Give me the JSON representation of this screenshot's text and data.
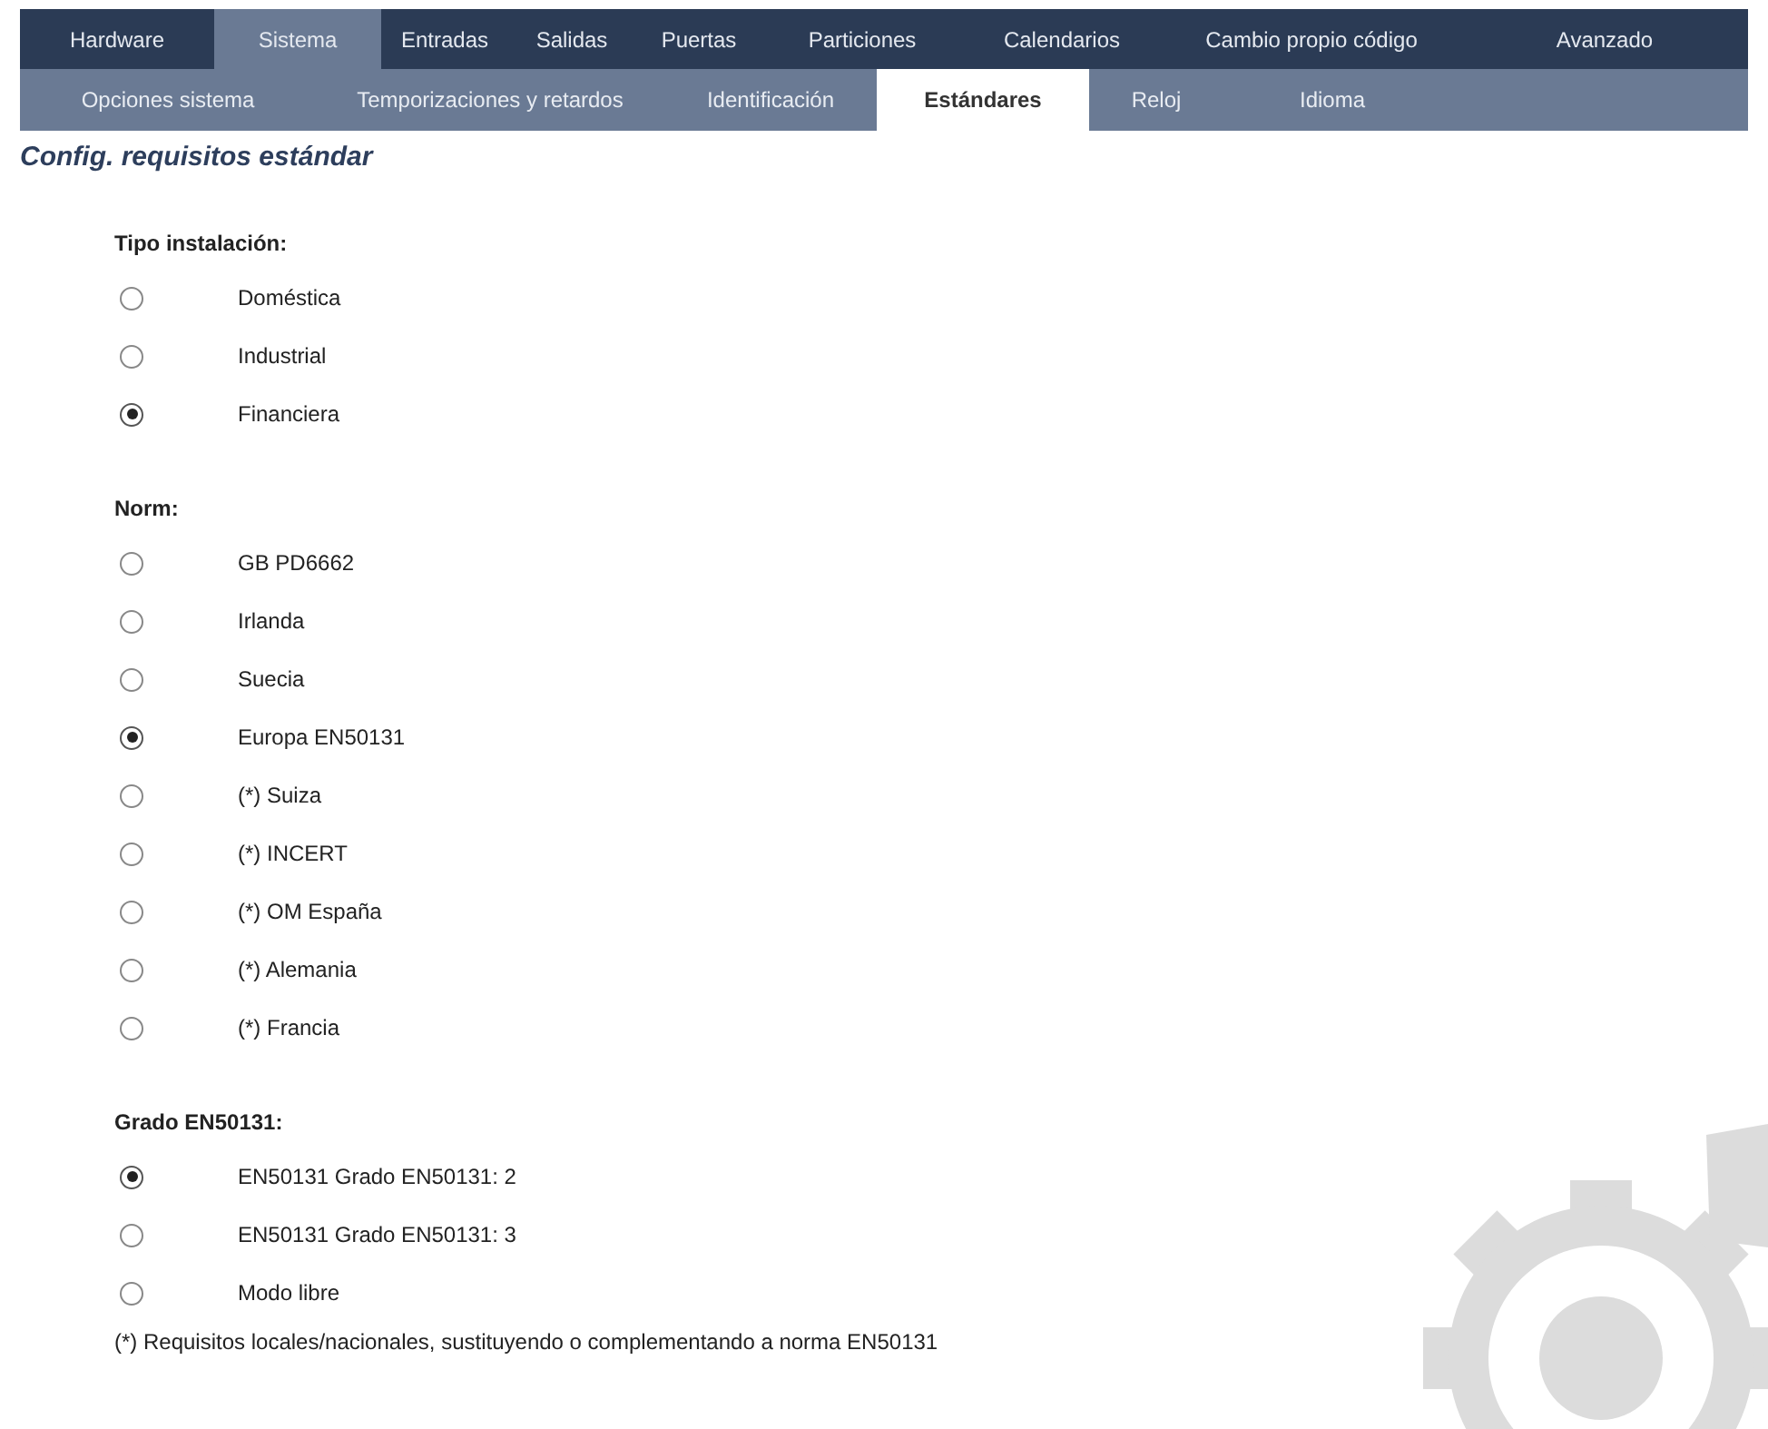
{
  "main_tabs": [
    {
      "label": "Hardware",
      "selected": false
    },
    {
      "label": "Sistema",
      "selected": true
    },
    {
      "label": "Entradas",
      "selected": false
    },
    {
      "label": "Salidas",
      "selected": false
    },
    {
      "label": "Puertas",
      "selected": false
    },
    {
      "label": "Particiones",
      "selected": false
    },
    {
      "label": "Calendarios",
      "selected": false
    },
    {
      "label": "Cambio propio código",
      "selected": false
    },
    {
      "label": "Avanzado",
      "selected": false
    }
  ],
  "sub_tabs": [
    {
      "label": "Opciones sistema",
      "selected": false
    },
    {
      "label": "Temporizaciones y retardos",
      "selected": false
    },
    {
      "label": "Identificación",
      "selected": false
    },
    {
      "label": "Estándares",
      "selected": true
    },
    {
      "label": "Reloj",
      "selected": false
    },
    {
      "label": "Idioma",
      "selected": false
    }
  ],
  "title": "Config. requisitos estándar",
  "groups": [
    {
      "heading": "Tipo instalación:",
      "options": [
        {
          "label": "Doméstica",
          "selected": false
        },
        {
          "label": "Industrial",
          "selected": false
        },
        {
          "label": "Financiera",
          "selected": true
        }
      ]
    },
    {
      "heading": "Norm:",
      "options": [
        {
          "label": "GB PD6662",
          "selected": false
        },
        {
          "label": "Irlanda",
          "selected": false
        },
        {
          "label": "Suecia",
          "selected": false
        },
        {
          "label": "Europa EN50131",
          "selected": true
        },
        {
          "label": "(*) Suiza",
          "selected": false
        },
        {
          "label": "(*) INCERT",
          "selected": false
        },
        {
          "label": "(*) OM España",
          "selected": false
        },
        {
          "label": "(*) Alemania",
          "selected": false
        },
        {
          "label": "(*) Francia",
          "selected": false
        }
      ]
    },
    {
      "heading": "Grado EN50131:",
      "options": [
        {
          "label": "EN50131 Grado EN50131: 2",
          "selected": true
        },
        {
          "label": "EN50131 Grado EN50131: 3",
          "selected": false
        },
        {
          "label": "Modo libre",
          "selected": false
        }
      ]
    }
  ],
  "footnote": "(*) Requisitos locales/nacionales, sustituyendo o complementando a norma EN50131"
}
